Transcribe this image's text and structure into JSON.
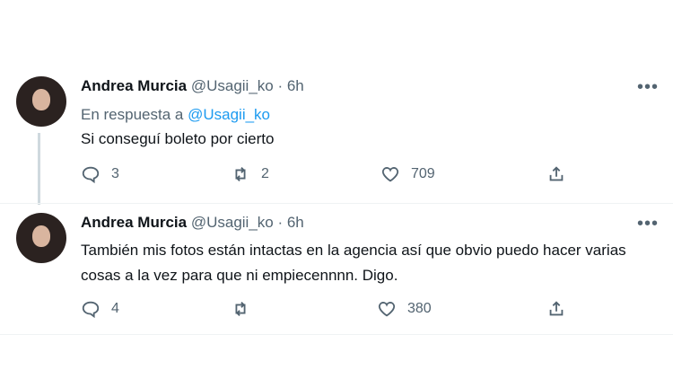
{
  "tweets": [
    {
      "name": "Andrea Murcia",
      "handle": "@Usagii_ko",
      "time": "· 6h",
      "reply_prefix": "En respuesta a",
      "reply_to": "@Usagii_ko",
      "text": "Si conseguí boleto por cierto",
      "replies": "3",
      "retweets": "2",
      "likes": "709"
    },
    {
      "name": "Andrea Murcia",
      "handle": "@Usagii_ko",
      "time": "· 6h",
      "text": "También mis fotos están intactas en la agencia así que obvio puedo hacer varias cosas a la vez para que ni empiecennnn. Digo.",
      "replies": "4",
      "retweets": "",
      "likes": "380"
    }
  ],
  "icons": [
    "more-icon",
    "reply-icon",
    "retweet-icon",
    "like-icon",
    "share-icon"
  ],
  "colors": {
    "link": "#1d9bf0",
    "muted": "#536471",
    "text": "#0f1419"
  }
}
